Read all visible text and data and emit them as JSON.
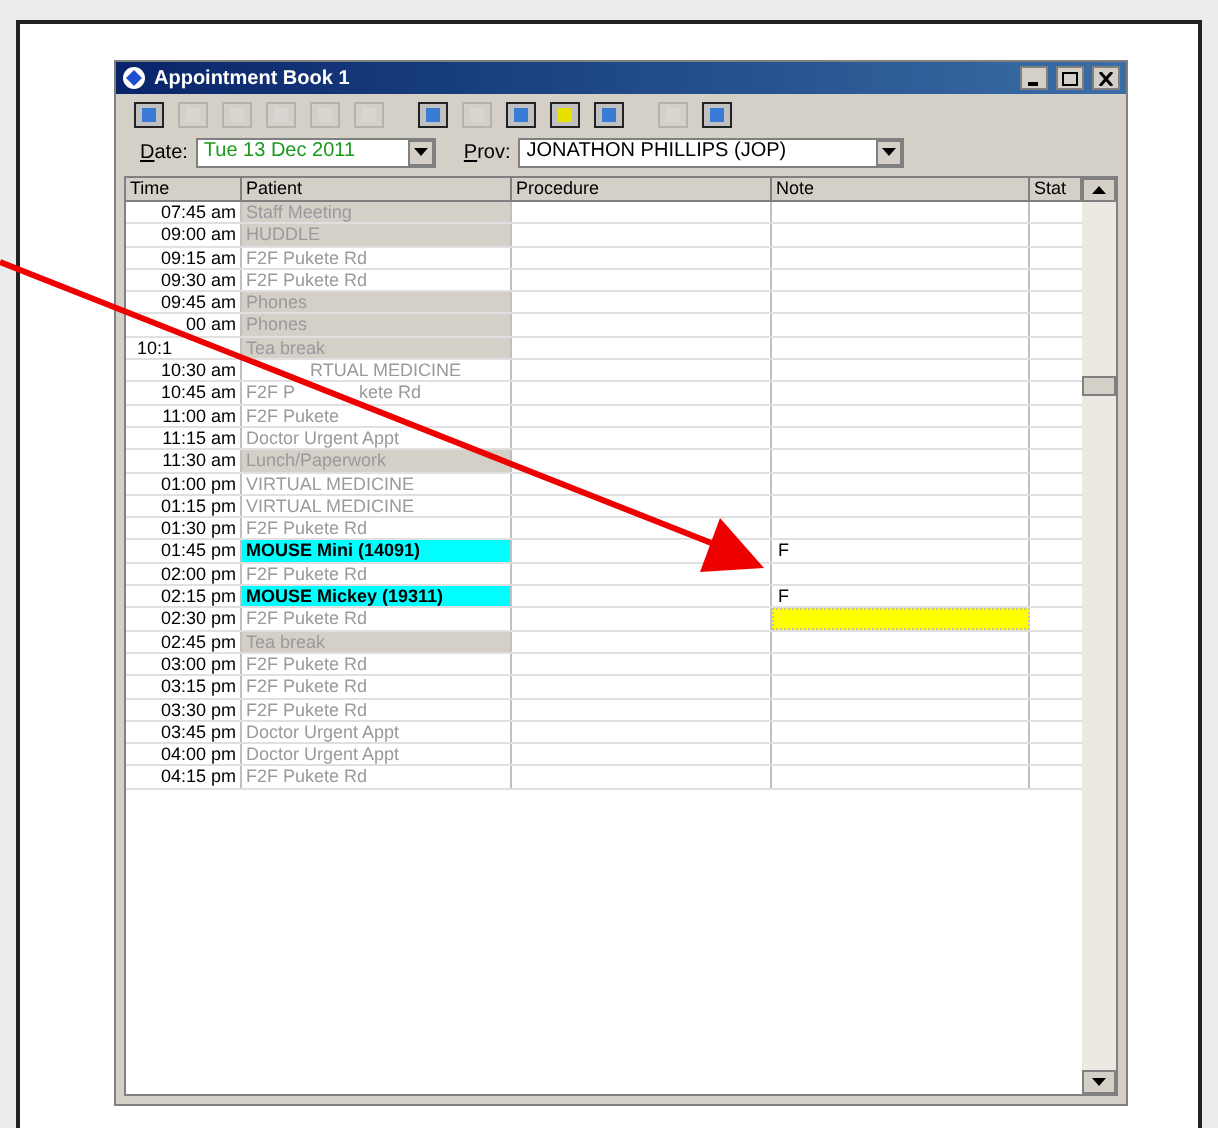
{
  "window": {
    "title": "Appointment Book 1"
  },
  "toolbar": [
    {
      "disabled": false
    },
    {
      "disabled": true
    },
    {
      "disabled": true
    },
    {
      "disabled": true
    },
    {
      "disabled": true
    },
    {
      "disabled": true
    },
    {
      "disabled": false
    },
    {
      "disabled": true
    },
    {
      "disabled": false
    },
    {
      "disabled": false
    },
    {
      "disabled": false
    },
    {
      "disabled": true
    },
    {
      "disabled": false
    }
  ],
  "date": {
    "label": "Date:",
    "value": "Tue 13 Dec 2011"
  },
  "provider": {
    "label": "Prov:",
    "value": "JONATHON PHILLIPS (JOP)"
  },
  "table": {
    "columns": [
      "Time",
      "Patient",
      "Procedure",
      "Note",
      "Stat"
    ],
    "rows": [
      {
        "time": "07:45 am",
        "patient": "Staff Meeting",
        "kind": "block",
        "note": "",
        "note_selected": false
      },
      {
        "time": "09:00 am",
        "patient": "HUDDLE",
        "kind": "block",
        "note": "",
        "note_selected": false
      },
      {
        "time": "09:15 am",
        "patient": "F2F Pukete Rd",
        "kind": "slot",
        "note": "",
        "note_selected": false
      },
      {
        "time": "09:30 am",
        "patient": "F2F Pukete Rd",
        "kind": "slot",
        "note": "",
        "note_selected": false
      },
      {
        "time": "09:45 am",
        "patient": "Phones",
        "kind": "block",
        "note": "",
        "note_selected": false
      },
      {
        "time": "00 am",
        "patient": "Phones",
        "kind": "block",
        "note": "",
        "note_selected": false
      },
      {
        "time": "10:1",
        "time_covered_after": true,
        "patient": "Tea break",
        "kind": "block",
        "note": "",
        "note_selected": false
      },
      {
        "time": "10:30 am",
        "patient": "RTUAL MEDICINE",
        "patient_covered_before": true,
        "kind": "slot",
        "note": "",
        "note_selected": false
      },
      {
        "time": "10:45 am",
        "patient": "F2F P",
        "patient_rest": "kete Rd",
        "kind": "slot",
        "note": "",
        "note_selected": false
      },
      {
        "time": "11:00 am",
        "patient": "F2F Pukete",
        "kind": "slot",
        "note": "",
        "note_selected": false
      },
      {
        "time": "11:15 am",
        "patient": "Doctor Urgent Appt",
        "kind": "slot",
        "note": "",
        "note_selected": false
      },
      {
        "time": "11:30 am",
        "patient": "Lunch/Paperwork",
        "kind": "block",
        "note": "",
        "note_selected": false
      },
      {
        "time": "01:00 pm",
        "patient": "VIRTUAL MEDICINE",
        "kind": "slot",
        "note": "",
        "note_selected": false
      },
      {
        "time": "01:15 pm",
        "patient": "VIRTUAL MEDICINE",
        "kind": "slot",
        "note": "",
        "note_selected": false
      },
      {
        "time": "01:30 pm",
        "patient": "F2F Pukete Rd",
        "kind": "slot",
        "note": "",
        "note_selected": false
      },
      {
        "time": "01:45 pm",
        "patient": "MOUSE Mini (14091)",
        "kind": "patient",
        "note": "F",
        "note_selected": false
      },
      {
        "time": "02:00 pm",
        "patient": "F2F Pukete Rd",
        "kind": "slot",
        "note": "",
        "note_selected": false
      },
      {
        "time": "02:15 pm",
        "patient": "MOUSE Mickey (19311)",
        "kind": "patient",
        "note": "F",
        "note_selected": false
      },
      {
        "time": "02:30 pm",
        "patient": "F2F Pukete Rd",
        "kind": "slot",
        "note": "",
        "note_selected": true
      },
      {
        "time": "02:45 pm",
        "patient": "Tea break",
        "kind": "block",
        "note": "",
        "note_selected": false
      },
      {
        "time": "03:00 pm",
        "patient": "F2F Pukete Rd",
        "kind": "slot",
        "note": "",
        "note_selected": false
      },
      {
        "time": "03:15 pm",
        "patient": "F2F Pukete Rd",
        "kind": "slot",
        "note": "",
        "note_selected": false
      },
      {
        "time": "03:30 pm",
        "patient": "F2F Pukete Rd",
        "kind": "slot",
        "note": "",
        "note_selected": false
      },
      {
        "time": "03:45 pm",
        "patient": "Doctor Urgent Appt",
        "kind": "slot",
        "note": "",
        "note_selected": false
      },
      {
        "time": "04:00 pm",
        "patient": "Doctor Urgent Appt",
        "kind": "slot",
        "note": "",
        "note_selected": false
      },
      {
        "time": "04:15 pm",
        "patient": "F2F Pukete Rd",
        "kind": "slot",
        "note": "",
        "note_selected": false
      }
    ]
  }
}
